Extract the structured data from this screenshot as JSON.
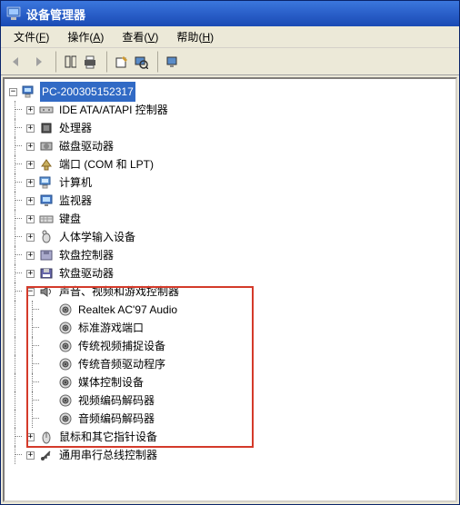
{
  "window": {
    "title": "设备管理器"
  },
  "menubar": [
    {
      "label": "文件",
      "accel": "F"
    },
    {
      "label": "操作",
      "accel": "A"
    },
    {
      "label": "查看",
      "accel": "V"
    },
    {
      "label": "帮助",
      "accel": "H"
    }
  ],
  "tree": {
    "root": {
      "label": "PC-200305152317",
      "icon": "computer",
      "expanded": true,
      "selected": true
    },
    "categories": [
      {
        "label": "IDE ATA/ATAPI 控制器",
        "icon": "ide",
        "expanded": false
      },
      {
        "label": "处理器",
        "icon": "cpu",
        "expanded": false
      },
      {
        "label": "磁盘驱动器",
        "icon": "disk",
        "expanded": false
      },
      {
        "label": "端口 (COM 和 LPT)",
        "icon": "port",
        "expanded": false
      },
      {
        "label": "计算机",
        "icon": "computer-cat",
        "expanded": false
      },
      {
        "label": "监视器",
        "icon": "monitor",
        "expanded": false
      },
      {
        "label": "键盘",
        "icon": "keyboard",
        "expanded": false
      },
      {
        "label": "人体学输入设备",
        "icon": "hid",
        "expanded": false
      },
      {
        "label": "软盘控制器",
        "icon": "floppyctl",
        "expanded": false
      },
      {
        "label": "软盘驱动器",
        "icon": "floppy",
        "expanded": false
      },
      {
        "label": "声音、视频和游戏控制器",
        "icon": "sound",
        "expanded": true,
        "children": [
          {
            "label": "Realtek AC'97 Audio",
            "icon": "audio"
          },
          {
            "label": "标准游戏端口",
            "icon": "audio"
          },
          {
            "label": "传统视频捕捉设备",
            "icon": "audio"
          },
          {
            "label": "传统音频驱动程序",
            "icon": "audio"
          },
          {
            "label": "媒体控制设备",
            "icon": "audio"
          },
          {
            "label": "视频编码解码器",
            "icon": "audio"
          },
          {
            "label": "音频编码解码器",
            "icon": "audio"
          }
        ]
      },
      {
        "label": "鼠标和其它指针设备",
        "icon": "mouse",
        "expanded": false
      },
      {
        "label": "通用串行总线控制器",
        "icon": "usb",
        "expanded": false
      }
    ]
  }
}
